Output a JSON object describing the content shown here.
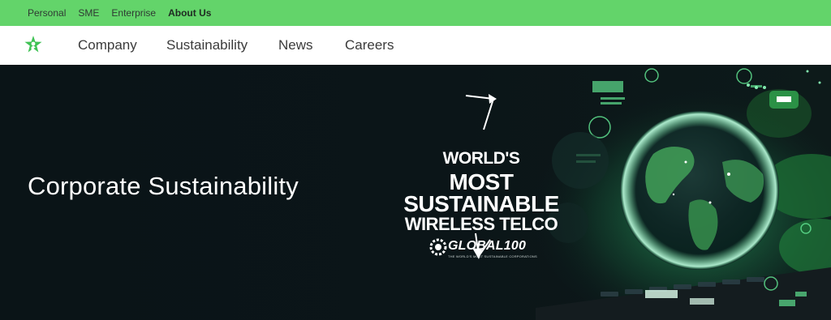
{
  "top_bar": {
    "links": [
      "Personal",
      "SME",
      "Enterprise",
      "About Us"
    ]
  },
  "nav": {
    "logo_icon": "star-person-logo-icon",
    "links": [
      "Company",
      "Sustainability",
      "News",
      "Careers"
    ]
  },
  "hero": {
    "title": "Corporate Sustainability",
    "badge": {
      "line1": "WORLD'S",
      "line2": "MOST",
      "line3": "SUSTAINABLE",
      "line4": "WIRELESS TELCO"
    },
    "global_logo": {
      "text": "GLOBAL100",
      "subtitle": "THE WORLD'S MOST SUSTAINABLE CORPORATIONS"
    }
  },
  "colors": {
    "top_bar": "#63d46a",
    "hero_bg": "#0b1417",
    "accent_green": "#39e37a"
  }
}
